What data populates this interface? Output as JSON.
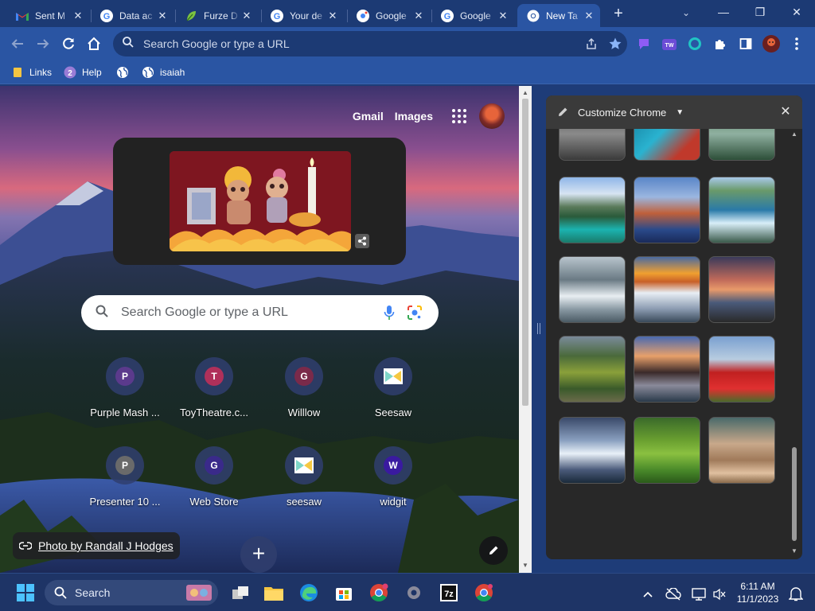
{
  "tabs": [
    {
      "title": "Sent M",
      "favicon": "gmail-icon",
      "active": false
    },
    {
      "title": "Data ac",
      "favicon": "google-icon",
      "active": false
    },
    {
      "title": "Furze D",
      "favicon": "leaf-icon",
      "active": false
    },
    {
      "title": "Your de",
      "favicon": "google-icon",
      "active": false
    },
    {
      "title": "Google",
      "favicon": "google-lens-icon",
      "active": false
    },
    {
      "title": "Google",
      "favicon": "google-icon",
      "active": false
    },
    {
      "title": "New Ta",
      "favicon": "chrome-icon",
      "active": true
    }
  ],
  "toolbar": {
    "omnibox_placeholder": "Search Google or type a URL"
  },
  "bookmarks": [
    {
      "label": "Links",
      "icon": "folder-icon"
    },
    {
      "label": "Help",
      "icon": "help-icon"
    },
    {
      "label": "",
      "icon": "globe-icon"
    },
    {
      "label": "isaiah",
      "icon": "globe-icon"
    }
  ],
  "ntp": {
    "gmail": "Gmail",
    "images": "Images",
    "search_placeholder": "Search Google or type a URL",
    "photo_credit": "Photo by Randall J Hodges",
    "shortcuts": [
      {
        "label": "Purple Mash ...",
        "letter": "P",
        "color": "#5b3a8c"
      },
      {
        "label": "ToyTheatre.c...",
        "letter": "T",
        "color": "#b0305a"
      },
      {
        "label": "Willlow",
        "letter": "G",
        "color": "#7a2a4a"
      },
      {
        "label": "Seesaw",
        "letter": "",
        "color": "#ffffff"
      },
      {
        "label": "Presenter 10 ...",
        "letter": "P",
        "color": "#6a6a6a"
      },
      {
        "label": "Web Store",
        "letter": "G",
        "color": "#3a2a8a"
      },
      {
        "label": "seesaw",
        "letter": "",
        "color": "#ffffff"
      },
      {
        "label": "widgit",
        "letter": "W",
        "color": "#3a1aa0"
      }
    ]
  },
  "side_panel": {
    "title": "Customize Chrome"
  },
  "taskbar": {
    "search_label": "Search",
    "time": "6:11 AM",
    "date": "11/1/2023"
  },
  "colors": {
    "frame": "#1c3a74",
    "toolbar": "#2a55a3",
    "taskbar": "#1e3466"
  }
}
